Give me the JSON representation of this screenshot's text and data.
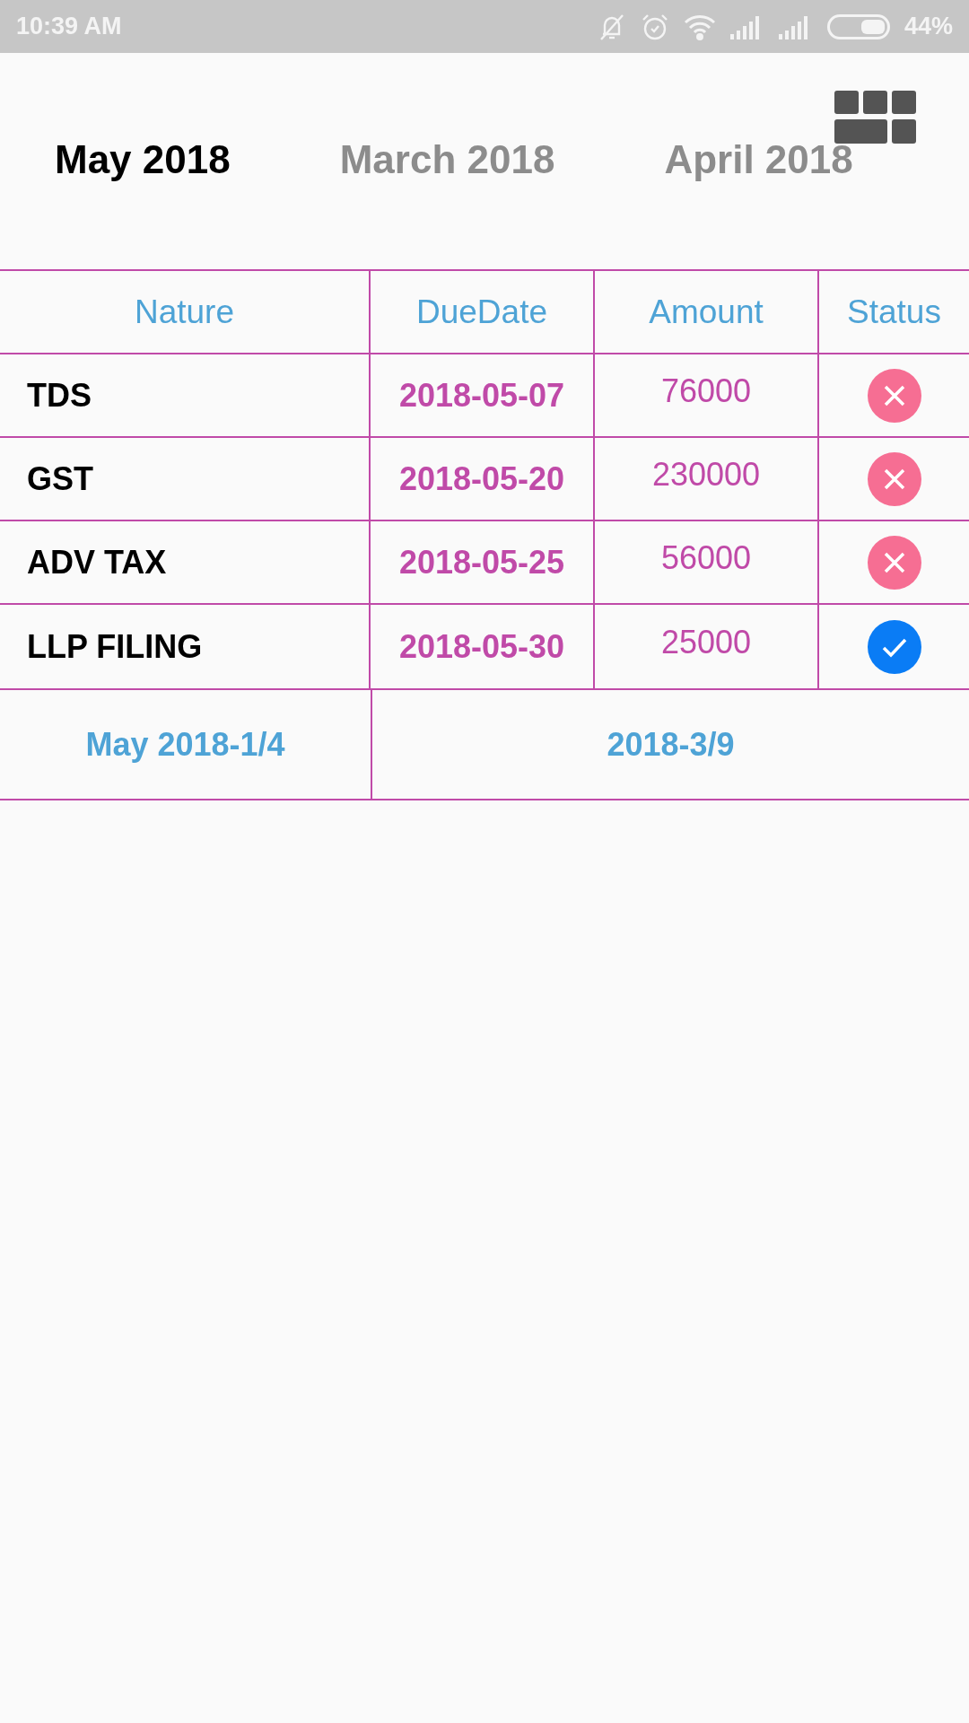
{
  "status_bar": {
    "time": "10:39 AM",
    "battery": "44%"
  },
  "tabs": [
    {
      "label": "May 2018",
      "selected": true
    },
    {
      "label": "March 2018",
      "selected": false
    },
    {
      "label": "April 2018",
      "selected": false
    }
  ],
  "table": {
    "columns": [
      "Nature",
      "DueDate",
      "Amount",
      "Status"
    ],
    "rows": [
      {
        "nature": "TDS",
        "due_date": "2018-05-07",
        "amount": "76000",
        "paid": false
      },
      {
        "nature": "GST",
        "due_date": "2018-05-20",
        "amount": "230000",
        "paid": false
      },
      {
        "nature": "ADV TAX",
        "due_date": "2018-05-25",
        "amount": "56000",
        "paid": false
      },
      {
        "nature": "LLP FILING",
        "due_date": "2018-05-30",
        "amount": "25000",
        "paid": true
      }
    ]
  },
  "footer": [
    "May 2018-1/4",
    "2018-3/9"
  ]
}
